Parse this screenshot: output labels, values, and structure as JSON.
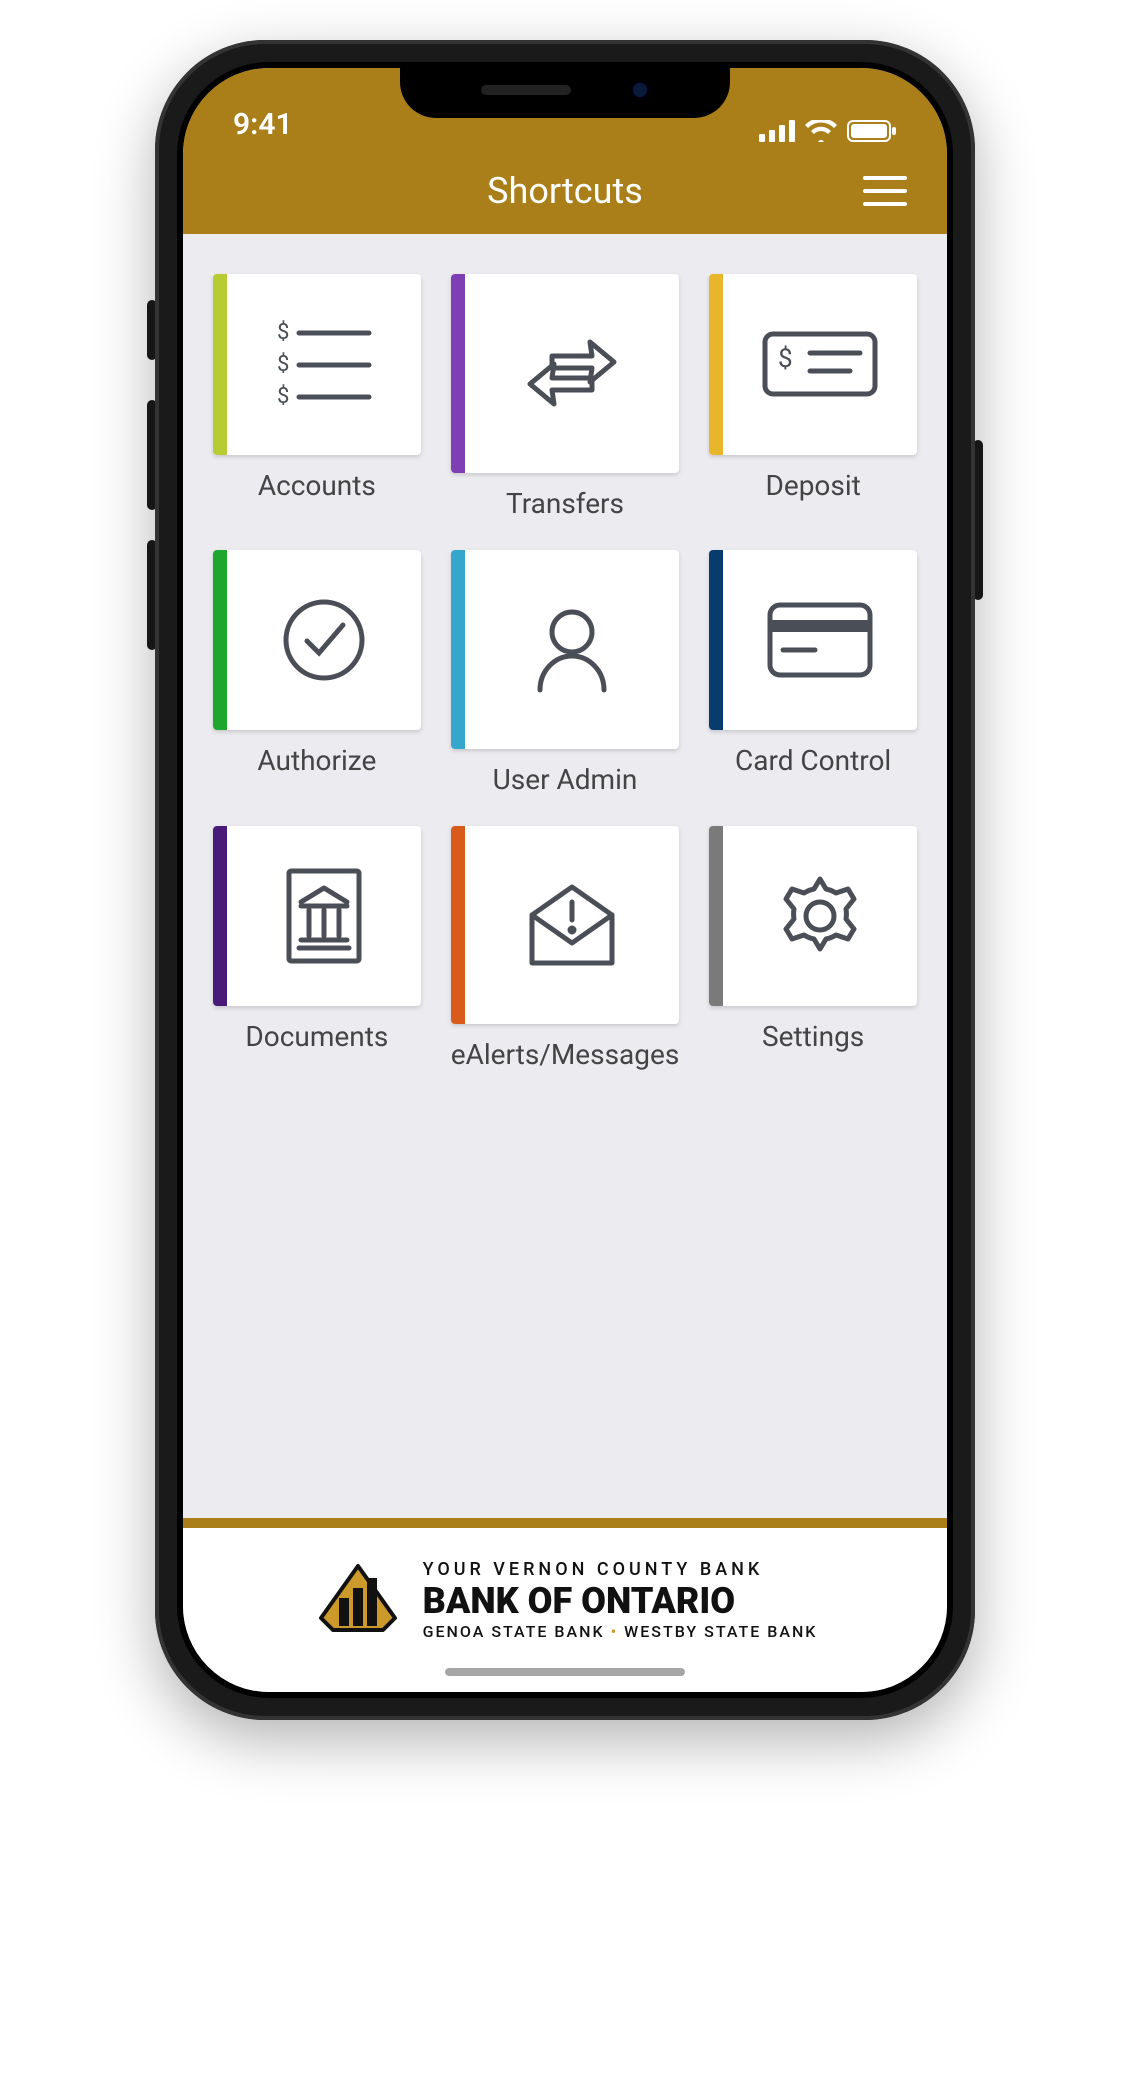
{
  "status": {
    "time": "9:41"
  },
  "header": {
    "title": "Shortcuts"
  },
  "tiles": [
    {
      "label": "Accounts",
      "color": "#b7cc33",
      "icon": "accounts"
    },
    {
      "label": "Transfers",
      "color": "#7e3fb5",
      "icon": "transfers"
    },
    {
      "label": "Deposit",
      "color": "#e8b62a",
      "icon": "deposit"
    },
    {
      "label": "Authorize",
      "color": "#1fa62f",
      "icon": "authorize"
    },
    {
      "label": "User Admin",
      "color": "#35a6cc",
      "icon": "user"
    },
    {
      "label": "Card Control",
      "color": "#0a3b6e",
      "icon": "card"
    },
    {
      "label": "Documents",
      "color": "#4a1a7a",
      "icon": "documents"
    },
    {
      "label": "eAlerts/Messages",
      "color": "#d95a1a",
      "icon": "alerts"
    },
    {
      "label": "Settings",
      "color": "#7a7a7a",
      "icon": "settings"
    }
  ],
  "footer": {
    "line1": "YOUR VERNON COUNTY BANK",
    "line2": "BANK OF ONTARIO",
    "line3a": "GENOA STATE BANK",
    "line3b": "WESTBY STATE BANK"
  }
}
